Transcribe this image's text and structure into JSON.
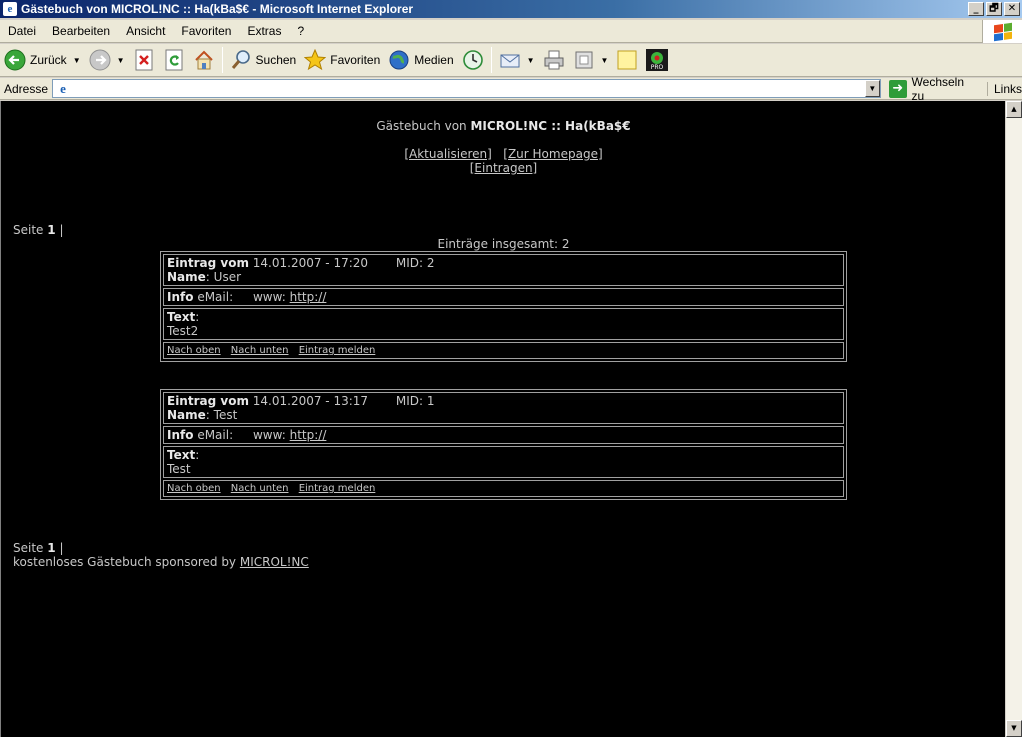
{
  "window": {
    "title": "Gästebuch von MICROL!NC :: Ha(kBa$€ - Microsoft Internet Explorer",
    "buttons": [
      "_",
      "🗗",
      "✕"
    ]
  },
  "menu": [
    "Datei",
    "Bearbeiten",
    "Ansicht",
    "Favoriten",
    "Extras",
    "?"
  ],
  "toolbar": {
    "back_label": "Zurück",
    "search_label": "Suchen",
    "favorites_label": "Favoriten",
    "media_label": "Medien"
  },
  "address": {
    "label": "Adresse",
    "value": "",
    "go_label": "Wechseln zu",
    "links_label": "Links"
  },
  "page": {
    "heading_prefix": "Gästebuch von ",
    "heading_bold": "MICROL!NC :: Ha(kBa$€",
    "nav": {
      "refresh": "[Aktualisieren]",
      "homepage": "[Zur Homepage]",
      "sign": "[Eintragen]"
    },
    "pager_label": "Seite",
    "pager_current": "1",
    "pager_sep": "|",
    "total_text": "Einträge insgesamt: 2",
    "entries": [
      {
        "header_label": "Eintrag vom",
        "date": "14.01.2007 - 17:20",
        "mid": "MID: 2",
        "name_label": "Name",
        "name": ": User",
        "info_label": "Info",
        "email": "eMail:",
        "www": "www:",
        "url": "http://",
        "text_label": "Text",
        "text_colon": ":",
        "text": "Test2",
        "links": [
          "Nach oben",
          "Nach unten",
          "Eintrag melden"
        ]
      },
      {
        "header_label": "Eintrag vom",
        "date": "14.01.2007 - 13:17",
        "mid": "MID: 1",
        "name_label": "Name",
        "name": ": Test",
        "info_label": "Info",
        "email": "eMail:",
        "www": "www:",
        "url": "http://",
        "text_label": "Text",
        "text_colon": ":",
        "text": "Test",
        "links": [
          "Nach oben",
          "Nach unten",
          "Eintrag melden"
        ]
      }
    ],
    "footer_text": "kostenloses Gästebuch sponsored by ",
    "footer_link": "MICROL!NC"
  }
}
